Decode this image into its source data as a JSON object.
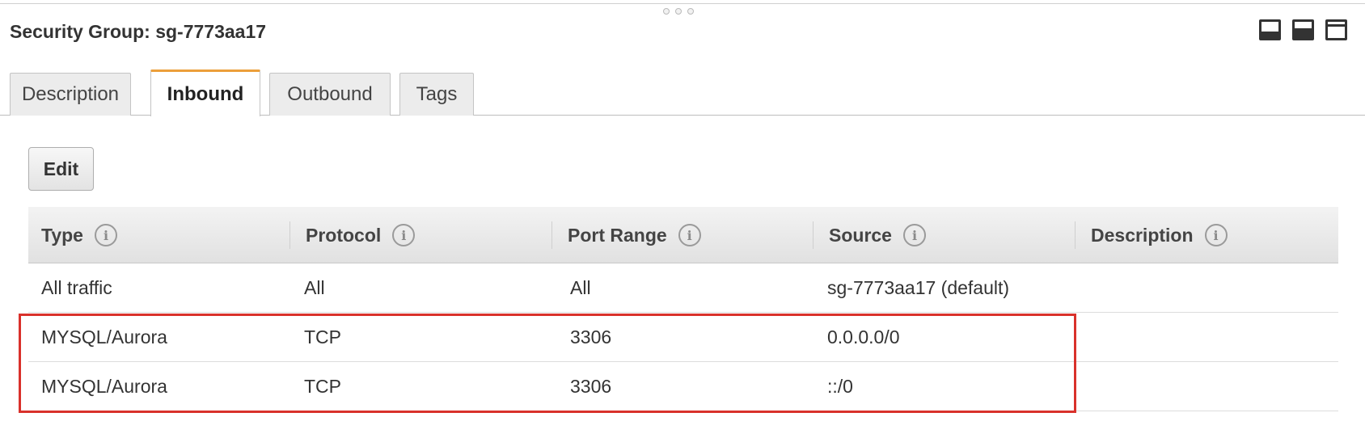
{
  "panel": {
    "title": "Security Group: sg-7773aa17",
    "layout_buttons": [
      "panel-bottom-icon",
      "panel-half-icon",
      "panel-maximize-icon"
    ]
  },
  "tabs": [
    {
      "label": "Description",
      "active": false
    },
    {
      "label": "Inbound",
      "active": true
    },
    {
      "label": "Outbound",
      "active": false
    },
    {
      "label": "Tags",
      "active": false
    }
  ],
  "toolbar": {
    "edit_label": "Edit"
  },
  "table": {
    "columns": [
      "Type",
      "Protocol",
      "Port Range",
      "Source",
      "Description"
    ],
    "info_glyph": "i",
    "rows": [
      {
        "type": "All traffic",
        "protocol": "All",
        "port_range": "All",
        "source": "sg-7773aa17 (default)",
        "description": ""
      },
      {
        "type": "MYSQL/Aurora",
        "protocol": "TCP",
        "port_range": "3306",
        "source": "0.0.0.0/0",
        "description": ""
      },
      {
        "type": "MYSQL/Aurora",
        "protocol": "TCP",
        "port_range": "3306",
        "source": "::/0",
        "description": ""
      }
    ]
  },
  "colors": {
    "active_tab_accent": "#ec9f3a",
    "highlight_border": "#d9312b"
  }
}
